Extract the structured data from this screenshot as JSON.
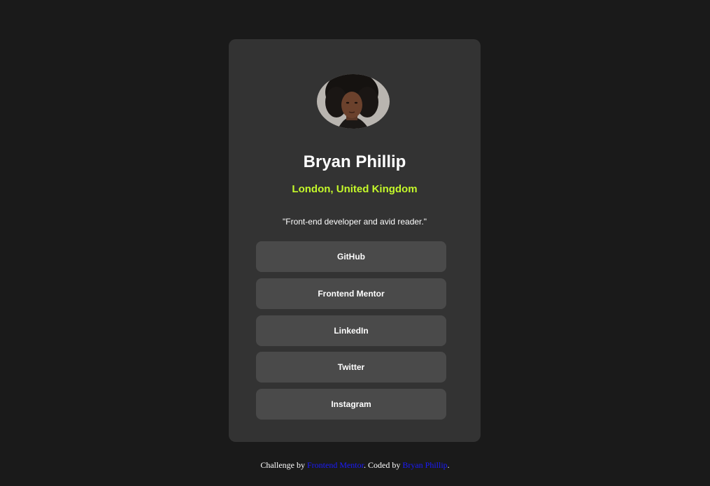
{
  "profile": {
    "name": "Bryan Phillip",
    "location": "London, United Kingdom",
    "bio": "\"Front-end developer and avid reader.\""
  },
  "links": [
    {
      "label": "GitHub"
    },
    {
      "label": "Frontend Mentor"
    },
    {
      "label": "LinkedIn"
    },
    {
      "label": "Twitter"
    },
    {
      "label": "Instagram"
    }
  ],
  "footer": {
    "prefix": "Challenge by ",
    "challenge_link": "Frontend Mentor",
    "middle": ". Coded by ",
    "author_link": "Bryan Phillip",
    "suffix": "."
  },
  "colors": {
    "page_background": "#1a1a1a",
    "card_background": "#333333",
    "button_background": "#4a4a4a",
    "accent": "#c4f82a",
    "footer_link": "#1a1aff"
  }
}
